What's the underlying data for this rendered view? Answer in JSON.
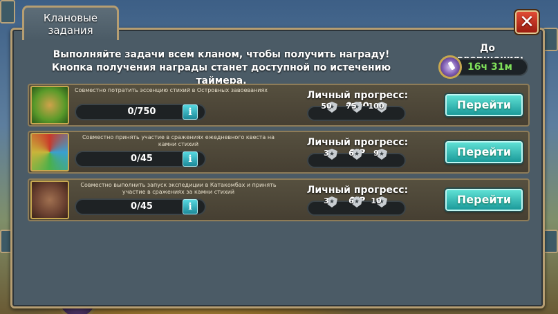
{
  "window": {
    "title_line1": "Клановые",
    "title_line2": "задания",
    "close_label": "✕"
  },
  "header": {
    "description": "Выполняйте задачи всем кланом, чтобы получить награду! Кнопка получения награды станет доступной по истечению таймера.",
    "timer_label": "До завершения:",
    "timer_value": "16ч 31м"
  },
  "tasks": [
    {
      "title": "Совместно потратить эссенцию стихий в Островных завоеваниях",
      "progress": "0/750",
      "info_label": "i",
      "personal_label": "Личный прогресс: 0/50",
      "milestones": [
        "50",
        "75",
        "100"
      ],
      "button_label": "Перейти",
      "icon": "shell-icon"
    },
    {
      "title": "Совместно принять участие в сражениях ежедневного квеста на камни стихий",
      "progress": "0/45",
      "info_label": "i",
      "personal_label": "Личный прогресс: 0/3",
      "milestones": [
        "3",
        "6",
        "9"
      ],
      "button_label": "Перейти",
      "icon": "elements-icon"
    },
    {
      "title": "Совместно выполнить запуск экспедиции в Катакомбах и принять участие в сражениях за камни стихий",
      "progress": "0/45",
      "info_label": "i",
      "personal_label": "Личный прогресс: 0/3",
      "milestones": [
        "3",
        "6",
        "10"
      ],
      "button_label": "Перейти",
      "icon": "catacombs-icon"
    }
  ],
  "colors": {
    "go_button": "#2bb5b0",
    "close_button": "#c9341f",
    "timer_text": "#7fe05a",
    "frame_border": "#b69e72"
  }
}
